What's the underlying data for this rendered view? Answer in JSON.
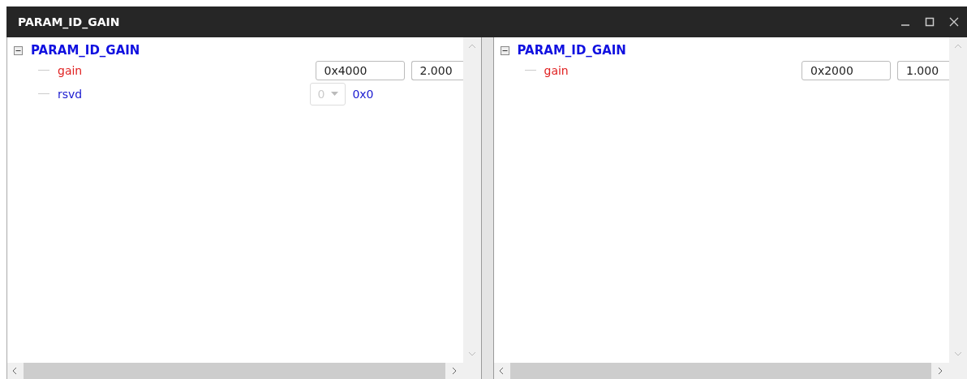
{
  "window": {
    "title": "PARAM_ID_GAIN"
  },
  "panes": [
    {
      "root": {
        "label": "PARAM_ID_GAIN",
        "expanded": true,
        "children": [
          {
            "kind": "input",
            "label": "gain",
            "color": "#e02020",
            "hex": "0x4000",
            "value": "2.000"
          },
          {
            "kind": "dropdown",
            "label": "rsvd",
            "color": "#1a1ad0",
            "selection": "0",
            "disabled": true,
            "hex": "0x0"
          }
        ]
      }
    },
    {
      "root": {
        "label": "PARAM_ID_GAIN",
        "expanded": true,
        "children": [
          {
            "kind": "input",
            "label": "gain",
            "color": "#e02020",
            "hex": "0x2000",
            "value": "1.000"
          }
        ]
      }
    }
  ]
}
